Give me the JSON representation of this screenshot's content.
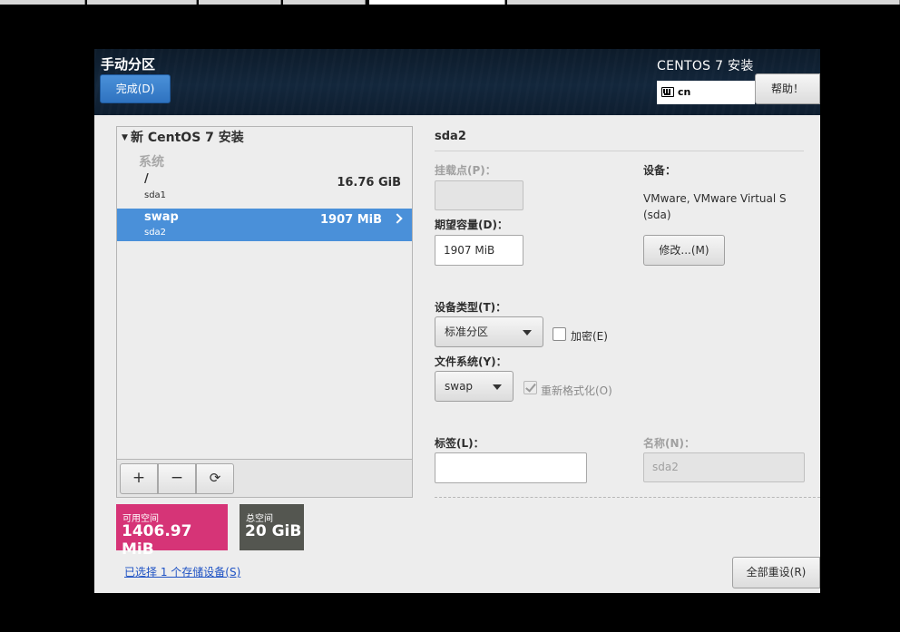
{
  "header": {
    "page_title": "手动分区",
    "done_label": "完成(D)",
    "product_title": "CENTOS 7 安装",
    "keyboard_layout": "cn",
    "help_label": "帮助！"
  },
  "partition_list": {
    "group_title": "新 CentOS 7 安装",
    "section_label": "系统",
    "rows": [
      {
        "mount": "/",
        "device": "sda1",
        "size": "16.76 GiB",
        "selected": false
      },
      {
        "mount": "swap",
        "device": "sda2",
        "size": "1907 MiB",
        "selected": true
      }
    ],
    "add_symbol": "+",
    "remove_symbol": "−",
    "refresh_symbol": "⟳"
  },
  "space": {
    "free_label": "可用空间",
    "free_value": "1406.97 MiB",
    "total_label": "总空间",
    "total_value": "20 GiB"
  },
  "storage_link": "已选择 1 个存储设备(S)",
  "details": {
    "title": "sda2",
    "mount_point_label": "挂载点(P)：",
    "mount_point_value": "",
    "desired_capacity_label": "期望容量(D)：",
    "desired_capacity_value": "1907 MiB",
    "devices_label": "设备：",
    "devices_value_line1": "VMware, VMware Virtual S",
    "devices_value_line2": "(sda)",
    "modify_label": "修改...(M)",
    "device_type_label": "设备类型(T)：",
    "device_type_value": "标准分区",
    "encrypt_label": "加密(E)",
    "filesystem_label": "文件系统(Y)：",
    "filesystem_value": "swap",
    "reformat_label": "重新格式化(O)",
    "tag_label": "标签(L)：",
    "tag_value": "",
    "name_label": "名称(N)：",
    "name_value": "sda2"
  },
  "reset_label": "全部重设(R)",
  "colors": {
    "selected_row": "#4a90d9",
    "free_space": "#d63477",
    "total_space": "#545650",
    "link": "#1e52c4"
  }
}
